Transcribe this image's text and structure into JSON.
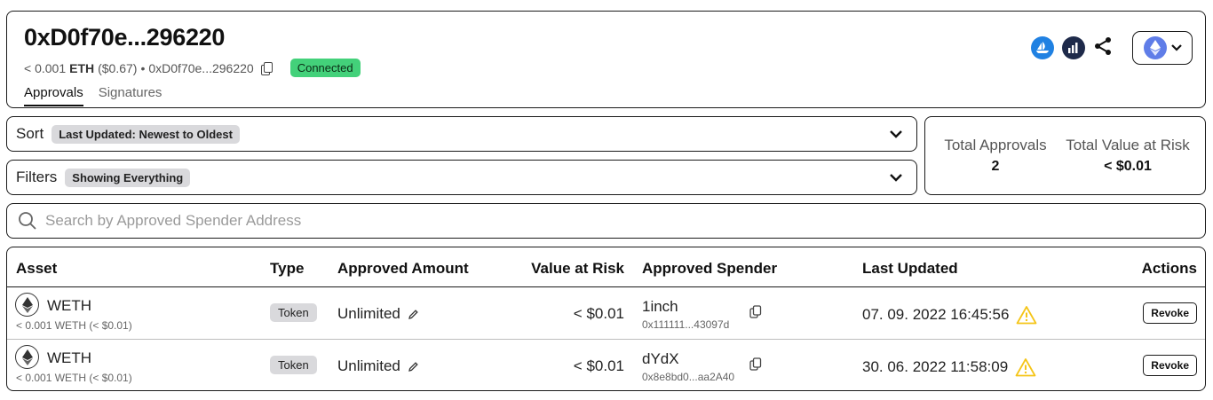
{
  "header": {
    "address_title": "0xD0f70e...296220",
    "balance_prefix": "< 0.001",
    "balance_unit": "ETH",
    "balance_usd": "($0.67)",
    "bullet": "•",
    "short_address": "0xD0f70e...296220",
    "status_badge": "Connected",
    "tabs": [
      {
        "label": "Approvals",
        "active": true
      },
      {
        "label": "Signatures",
        "active": false
      }
    ],
    "icons": [
      "opensea-icon",
      "dune-icon",
      "share-icon",
      "ethereum-icon",
      "chevron-down-icon"
    ]
  },
  "sort": {
    "label": "Sort",
    "value": "Last Updated: Newest to Oldest"
  },
  "filters": {
    "label": "Filters",
    "value": "Showing Everything"
  },
  "totals": {
    "approvals_label": "Total Approvals",
    "approvals_value": "2",
    "value_label": "Total Value at Risk",
    "value_value": "< $0.01"
  },
  "search": {
    "placeholder": "Search by Approved Spender Address",
    "value": ""
  },
  "table": {
    "columns": [
      "Asset",
      "Type",
      "Approved Amount",
      "Value at Risk",
      "Approved Spender",
      "Last Updated",
      "Actions"
    ],
    "rows": [
      {
        "asset": "WETH",
        "balance": "< 0.001 WETH (< $0.01)",
        "type": "Token",
        "amount": "Unlimited",
        "value_at_risk": "< $0.01",
        "spender_name": "1inch",
        "spender_address": "0x111111...43097d",
        "last_updated": "07. 09. 2022 16:45:56",
        "action": "Revoke"
      },
      {
        "asset": "WETH",
        "balance": "< 0.001 WETH (< $0.01)",
        "type": "Token",
        "amount": "Unlimited",
        "value_at_risk": "< $0.01",
        "spender_name": "dYdX",
        "spender_address": "0x8e8bd0...aa2A40",
        "last_updated": "30. 06. 2022 11:58:09",
        "action": "Revoke"
      }
    ]
  },
  "colors": {
    "connected_green": "#43d17a",
    "warning_yellow": "#f5c518",
    "opensea_blue": "#2081e2",
    "chip_gray": "#d9d9dc"
  }
}
